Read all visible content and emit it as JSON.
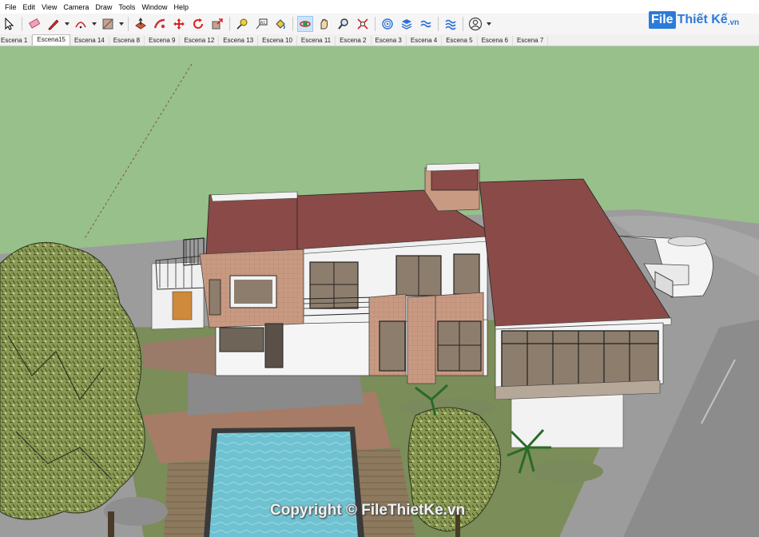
{
  "menu": [
    "File",
    "Edit",
    "View",
    "Camera",
    "Draw",
    "Tools",
    "Window",
    "Help"
  ],
  "scenes": [
    "Escena 1",
    "Escena15",
    "Escena 14",
    "Escena 8",
    "Escena 9",
    "Escena 12",
    "Escena 13",
    "Escena 10",
    "Escena 11",
    "Escena 2",
    "Escena 3",
    "Escena 4",
    "Escena 5",
    "Escena 6",
    "Escena 7"
  ],
  "active_scene": "Escena15",
  "logo": {
    "badge": "File",
    "name": "Thiết Kế",
    "domain": ".vn"
  },
  "watermark": "Copyright © FileThietKe.vn",
  "toolbar_icons": [
    "select-icon",
    "eraser-icon",
    "pencil-icon",
    "arc-icon",
    "shape-icon",
    "push-pull-icon",
    "follow-me-icon",
    "move-icon",
    "rotate-icon",
    "scale-icon",
    "tape-measure-icon",
    "text-icon",
    "paint-bucket-icon",
    "orbit-icon",
    "pan-icon",
    "zoom-icon",
    "zoom-extents-icon",
    "sandbox-icon",
    "layers-icon",
    "styles-icon",
    "fog-icon",
    "account-icon"
  ]
}
